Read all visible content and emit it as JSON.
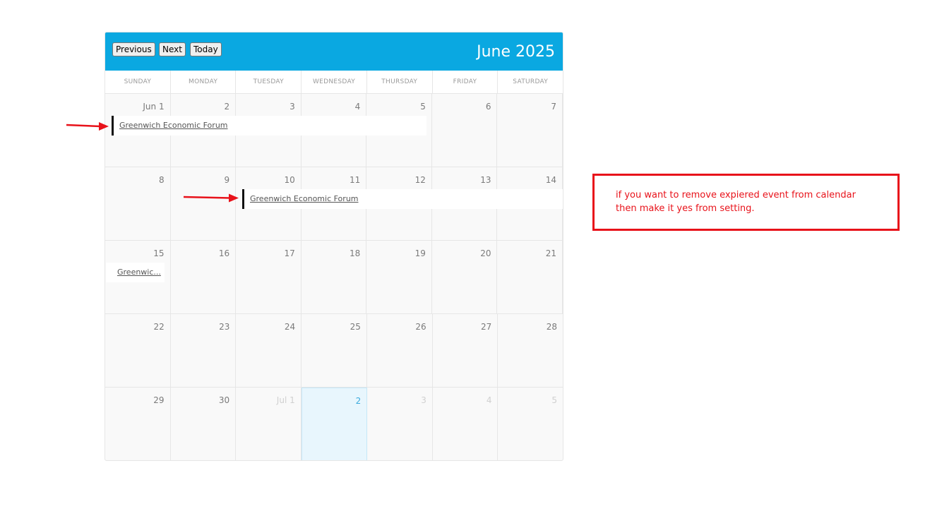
{
  "toolbar": {
    "previous_label": "Previous",
    "next_label": "Next",
    "today_label": "Today",
    "title": "June 2025"
  },
  "weekdays": [
    "SUNDAY",
    "MONDAY",
    "TUESDAY",
    "WEDNESDAY",
    "THURSDAY",
    "FRIDAY",
    "SATURDAY"
  ],
  "weeks": [
    [
      "Jun 1",
      "2",
      "3",
      "4",
      "5",
      "6",
      "7"
    ],
    [
      "8",
      "9",
      "10",
      "11",
      "12",
      "13",
      "14"
    ],
    [
      "15",
      "16",
      "17",
      "18",
      "19",
      "20",
      "21"
    ],
    [
      "22",
      "23",
      "24",
      "25",
      "26",
      "27",
      "28"
    ],
    [
      "29",
      "30",
      "Jul 1",
      "2",
      "3",
      "4",
      "5"
    ]
  ],
  "events": [
    {
      "title": "Greenwich Economic Forum"
    },
    {
      "title": "Greenwich Economic Forum"
    },
    {
      "title": "Greenwic..."
    }
  ],
  "note": {
    "text": "if you want to remove expiered event from calendar then make it yes from setting."
  },
  "colors": {
    "header": "#0aa8e1",
    "annotation": "#e8121a",
    "today_bg": "#e8f6fd"
  }
}
